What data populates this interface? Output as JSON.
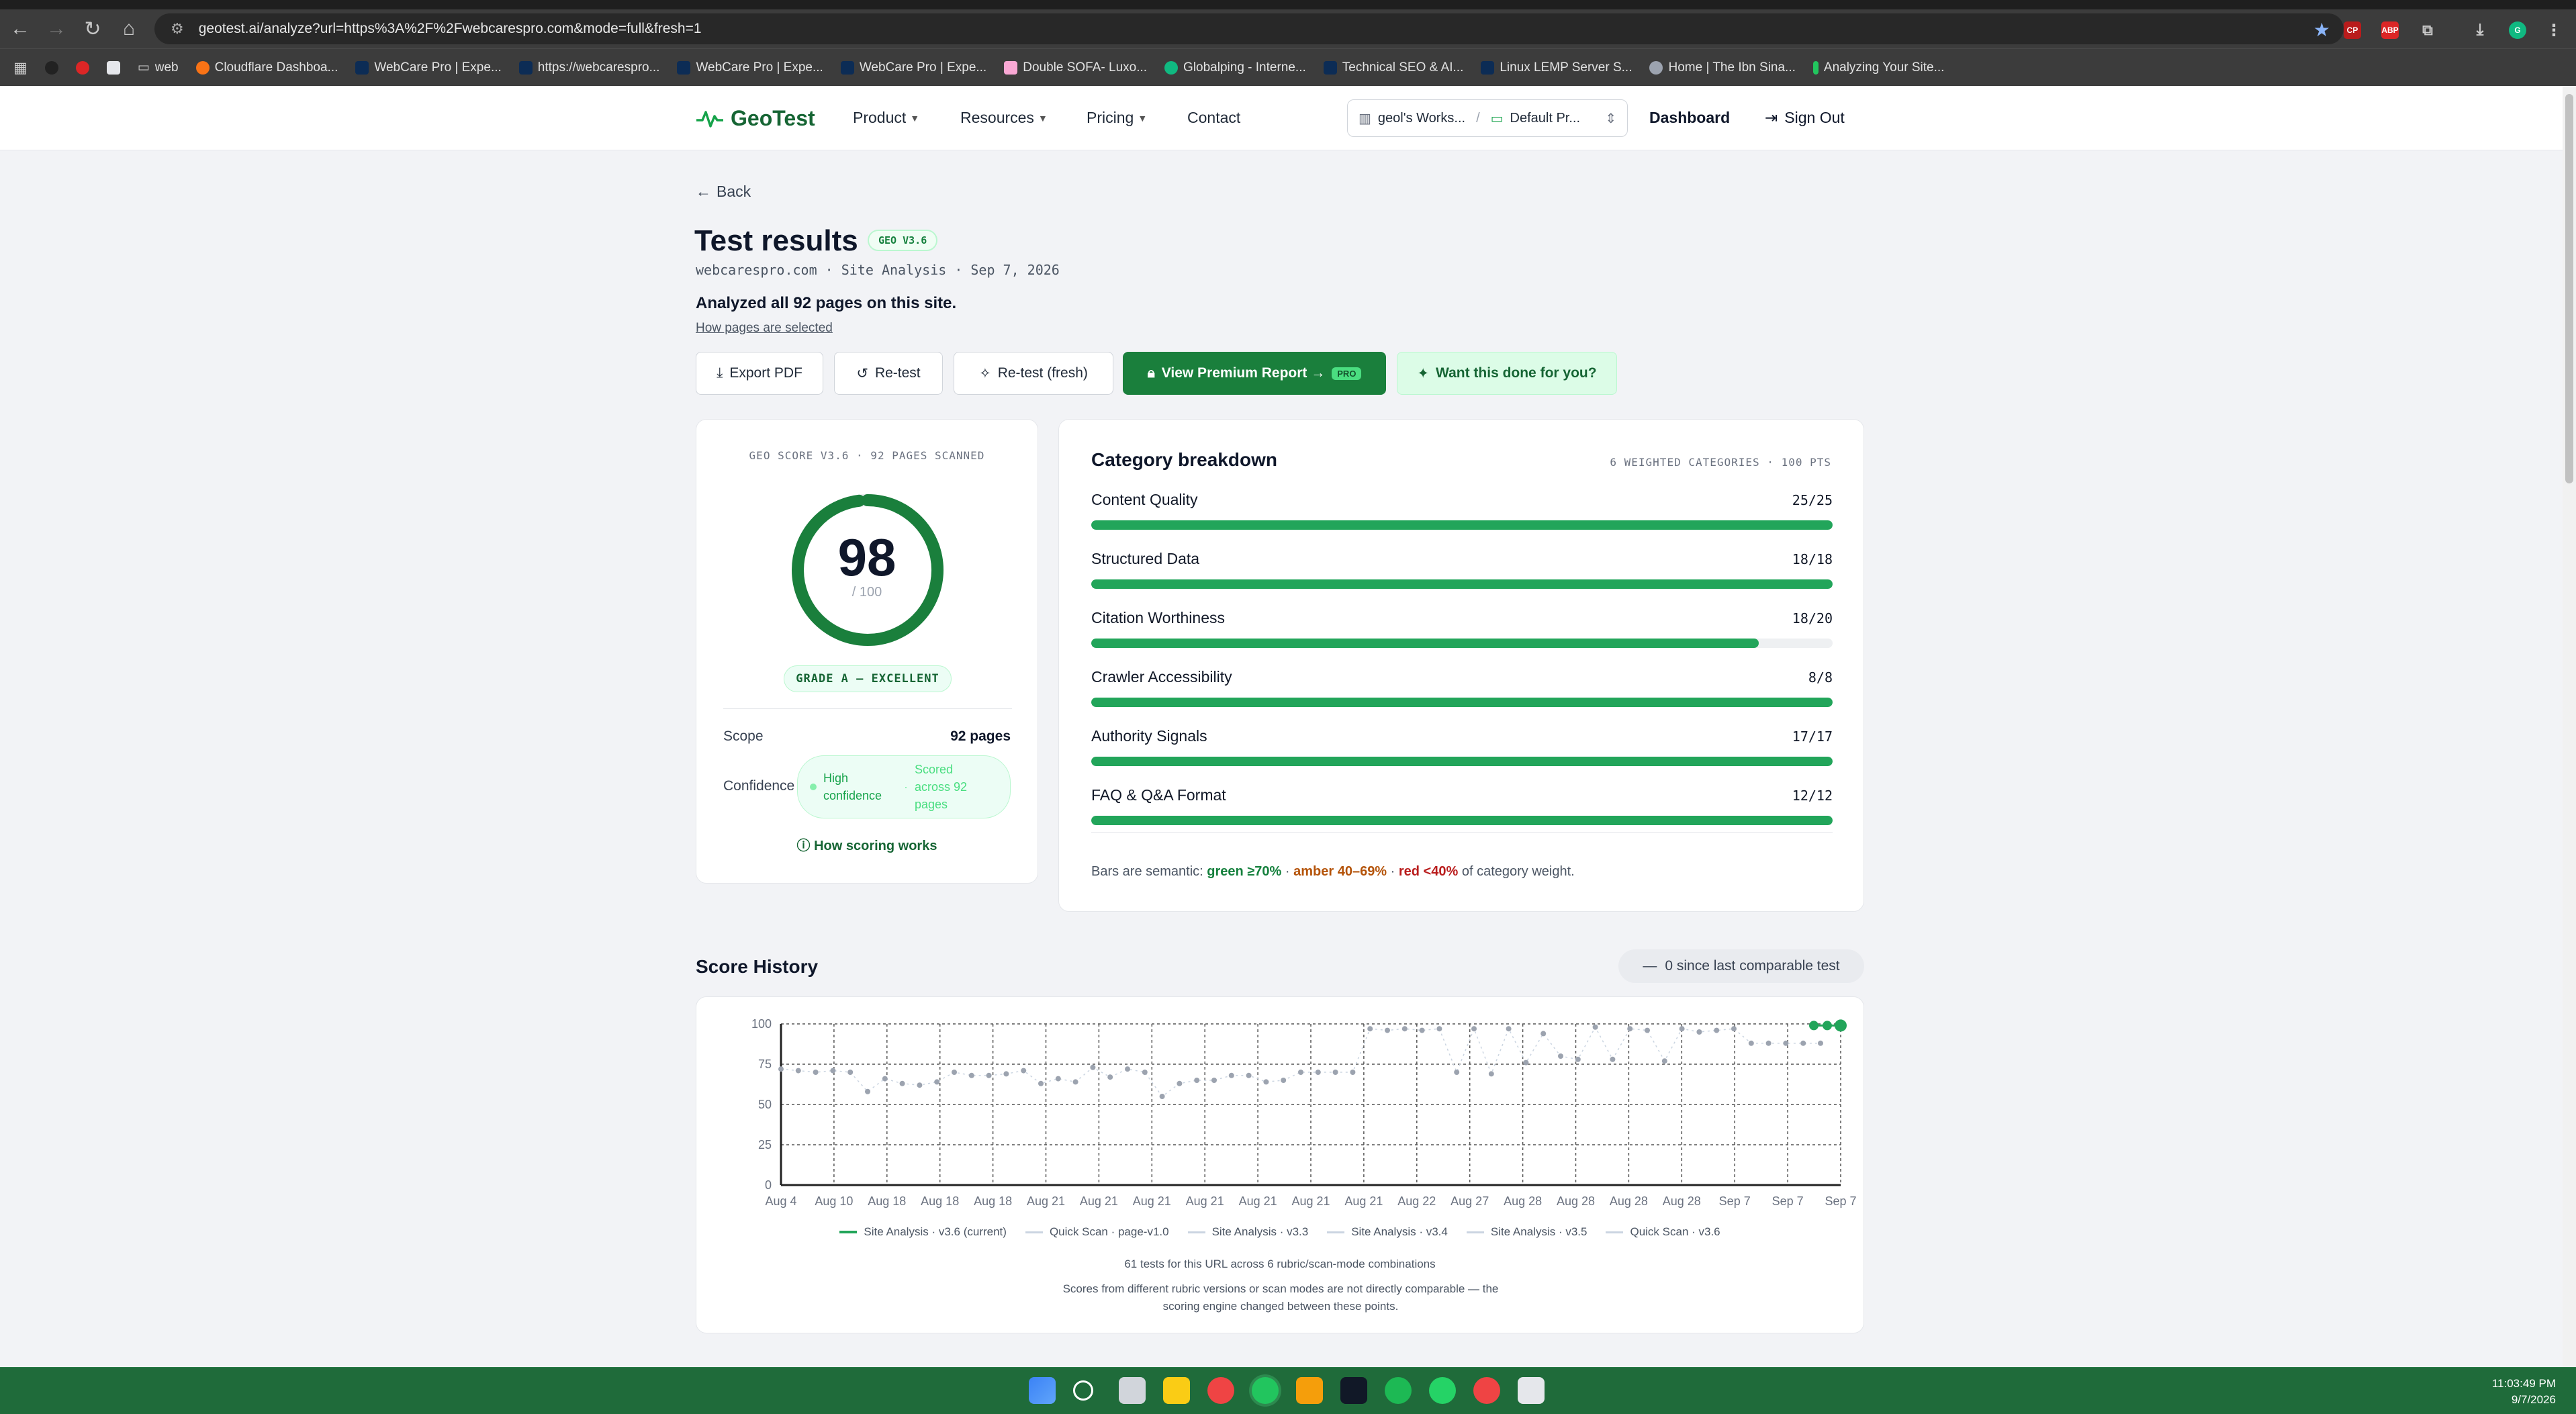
{
  "browser": {
    "url": "geotest.ai/analyze?url=https%3A%2F%2Fwebcarespro.com&mode=full&fresh=1",
    "bookmarks": [
      "web",
      "Cloudflare Dashboa...",
      "WebCare Pro | Expe...",
      "https://webcarespro...",
      "WebCare Pro | Expe...",
      "WebCare Pro | Expe...",
      "Double SOFA- Luxo...",
      "Globalping - Interne...",
      "Technical SEO & AI...",
      "Linux LEMP Server S...",
      "Home | The Ibn Sina...",
      "Analyzing Your Site..."
    ]
  },
  "header": {
    "logo": "GeoTest",
    "nav": [
      "Product",
      "Resources",
      "Pricing",
      "Contact"
    ],
    "workspace": "geol's Works...",
    "project": "Default Pr...",
    "dashboard": "Dashboard",
    "sign_out": "Sign Out"
  },
  "page": {
    "back": "Back",
    "title": "Test results",
    "version_badge": "GEO V3.6",
    "meta": "webcarespro.com · Site Analysis · Sep 7, 2026",
    "analyzed": "Analyzed all 92 pages on this site.",
    "how_pages": "How pages are selected",
    "actions": {
      "export": "Export PDF",
      "retest": "Re-test",
      "retest_fresh": "Re-test (fresh)",
      "premium": "View Premium Report →",
      "pro": "PRO",
      "done_for_you": "Want this done for you?"
    }
  },
  "score": {
    "label": "GEO SCORE V3.6 · 92 PAGES SCANNED",
    "value": 98,
    "value_text": "98",
    "max": "/ 100",
    "grade": "GRADE A — EXCELLENT",
    "scope_label": "Scope",
    "scope_value": "92 pages",
    "confidence_label": "Confidence",
    "confidence_level": "High confidence",
    "confidence_detail": "Scored across 92 pages",
    "how_scoring": "How scoring works"
  },
  "categories": {
    "title": "Category breakdown",
    "meta": "6 WEIGHTED CATEGORIES · 100 PTS",
    "items": [
      {
        "name": "Content Quality",
        "score": "25/25",
        "fraction": 1.0
      },
      {
        "name": "Structured Data",
        "score": "18/18",
        "fraction": 1.0
      },
      {
        "name": "Citation Worthiness",
        "score": "18/20",
        "fraction": 0.9
      },
      {
        "name": "Crawler Accessibility",
        "score": "8/8",
        "fraction": 1.0
      },
      {
        "name": "Authority Signals",
        "score": "17/17",
        "fraction": 1.0
      },
      {
        "name": "FAQ & Q&A Format",
        "score": "12/12",
        "fraction": 1.0
      }
    ],
    "semantic_prefix": "Bars are semantic:",
    "green": "green ≥70%",
    "amber": "amber 40–69%",
    "red": "red <40%",
    "semantic_suffix": "of category weight."
  },
  "history": {
    "title": "Score History",
    "since": "0 since last comparable test",
    "count": "61 tests for this URL across 6 rubric/scan-mode combinations",
    "note": "Scores from different rubric versions or scan modes are not directly comparable — the scoring engine changed between these points.",
    "legend": [
      "Site Analysis · v3.6 (current)",
      "Quick Scan · page-v1.0",
      "Site Analysis · v3.3",
      "Site Analysis · v3.4",
      "Site Analysis · v3.5",
      "Quick Scan · v3.6"
    ]
  },
  "chart_data": {
    "type": "scatter",
    "ylim": [
      0,
      100
    ],
    "y_ticks": [
      "0",
      "25",
      "50",
      "75",
      "100"
    ],
    "x_ticks": [
      "Aug 4",
      "Aug 10",
      "Aug 18",
      "Aug 18",
      "Aug 18",
      "Aug 21",
      "Aug 21",
      "Aug 21",
      "Aug 21",
      "Aug 21",
      "Aug 21",
      "Aug 21",
      "Aug 22",
      "Aug 27",
      "Aug 28",
      "Aug 28",
      "Aug 28",
      "Aug 28",
      "Sep 7",
      "Sep 7",
      "Sep 7"
    ],
    "values": [
      72,
      71,
      70,
      71,
      70,
      58,
      66,
      63,
      62,
      64,
      70,
      68,
      68,
      69,
      71,
      63,
      66,
      64,
      73,
      67,
      72,
      70,
      55,
      63,
      65,
      65,
      68,
      68,
      64,
      65,
      70,
      70,
      70,
      70,
      97,
      96,
      97,
      96,
      97,
      70,
      97,
      69,
      97,
      76,
      94,
      80,
      78,
      98,
      78,
      97,
      96,
      77,
      97,
      95,
      96,
      97,
      88,
      88,
      88,
      88,
      88
    ],
    "current_series": [
      99,
      99,
      99
    ],
    "colors": {
      "current": "#22a55a",
      "history": "#9ca3af"
    }
  },
  "system": {
    "time": "11:03:49 PM",
    "date": "9/7/2026"
  }
}
